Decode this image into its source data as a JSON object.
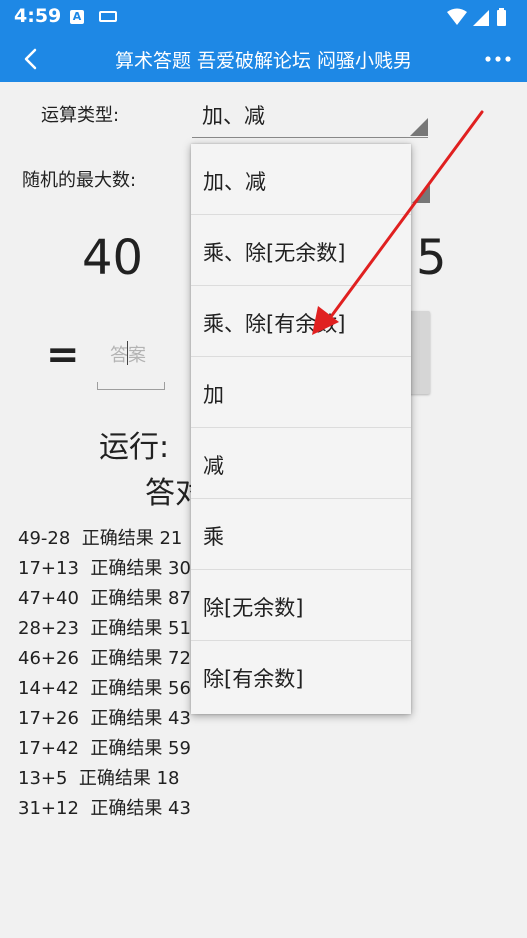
{
  "status_bar": {
    "time": "4:59",
    "icons": [
      "a-notification-icon",
      "keyboard-icon",
      "wifi-icon",
      "signal-icon",
      "battery-icon"
    ]
  },
  "app_bar": {
    "title": "算术答题 吾爱破解论坛 闷骚小贱男",
    "icons": [
      "back-arrow-icon",
      "more-vert-icon"
    ]
  },
  "form": {
    "operation_label": "运算类型:",
    "operation_value": "加、减",
    "max_label": "随机的最大数:"
  },
  "question": {
    "operand_left": "40",
    "operand_right": "5",
    "equals": "=",
    "answer_placeholder": "答案"
  },
  "run_label": "运行:",
  "result_label": "答对",
  "history": [
    "49-28  正确结果 21",
    "17+13  正确结果 30",
    "47+40  正确结果 87",
    "28+23  正确结果 51",
    "46+26  正确结果 72",
    "14+42  正确结果 56",
    "17+26  正确结果 43",
    "17+42  正确结果 59",
    "13+5  正确结果 18",
    "31+12  正确结果 43"
  ],
  "dropdown_options": [
    "加、减",
    "乘、除[无余数]",
    "乘、除[有余数]",
    "加",
    "减",
    "乘",
    "除[无余数]",
    "除[有余数]"
  ],
  "colors": {
    "app_bar": "#1e88e5",
    "annotation_arrow": "#e02020",
    "background": "#f1f1f1"
  }
}
